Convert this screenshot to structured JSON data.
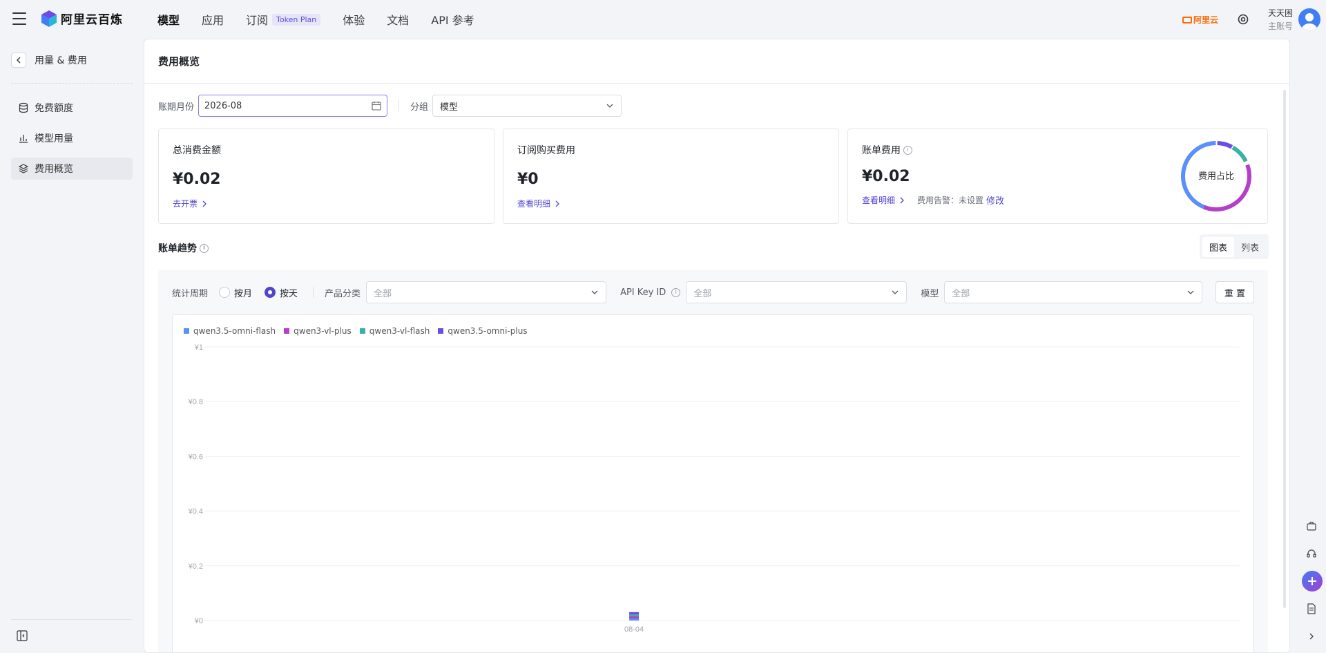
{
  "app": {
    "brand": "阿里云百炼",
    "aliyun_label": "阿里云"
  },
  "nav": {
    "items": [
      {
        "label": "模型",
        "active": true
      },
      {
        "label": "应用"
      },
      {
        "label": "订阅",
        "badge": "Token Plan"
      },
      {
        "label": "体验"
      },
      {
        "label": "文档"
      },
      {
        "label": "API 参考"
      }
    ]
  },
  "user": {
    "name": "天天困",
    "role": "主账号"
  },
  "sidebar": {
    "back_title": "用量 & 费用",
    "items": [
      {
        "label": "免费额度",
        "icon": "database-icon"
      },
      {
        "label": "模型用量",
        "icon": "bar-chart-icon"
      },
      {
        "label": "费用概览",
        "icon": "layers-icon",
        "active": true
      }
    ]
  },
  "page": {
    "title": "费用概览",
    "filters": {
      "month_label": "账期月份",
      "month_value": "2026-08",
      "group_label": "分组",
      "group_value": "模型"
    }
  },
  "cards": {
    "total": {
      "title": "总消费金额",
      "value": "¥0.02",
      "link": "去开票"
    },
    "subscription": {
      "title": "订阅购买费用",
      "value": "¥0",
      "link": "查看明细"
    },
    "bill": {
      "title": "账单费用",
      "value": "¥0.02",
      "link": "查看明细",
      "alert_text": "费用告警：未设置",
      "edit": "修改",
      "donut_label": "费用占比"
    }
  },
  "trend": {
    "title": "账单趋势",
    "view_toggle": [
      "图表",
      "列表"
    ],
    "active_view": "图表",
    "period_label": "统计周期",
    "period_options": [
      "按月",
      "按天"
    ],
    "period_selected": "按天",
    "product_label": "产品分类",
    "product_value": "全部",
    "apikey_label": "API Key ID",
    "apikey_value": "全部",
    "model_label": "模型",
    "model_value": "全部",
    "reset": "重 置"
  },
  "colors": {
    "accent": "#5145cd",
    "series": [
      "#5b8ff9",
      "#b53fc8",
      "#3bb0a6",
      "#6b4de6"
    ]
  },
  "chart_data": {
    "type": "bar",
    "stacked": true,
    "categories": [
      "08-04"
    ],
    "series": [
      {
        "name": "qwen3.5-omni-flash",
        "values": [
          0.004
        ]
      },
      {
        "name": "qwen3-vl-plus",
        "values": [
          0.006
        ]
      },
      {
        "name": "qwen3-vl-flash",
        "values": [
          0.002
        ]
      },
      {
        "name": "qwen3.5-omni-plus",
        "values": [
          0.008
        ]
      }
    ],
    "ylim": [
      0,
      1
    ],
    "yticks": [
      "¥0",
      "¥0.2",
      "¥0.4",
      "¥0.6",
      "¥0.8",
      "¥1"
    ],
    "legend": "top-left",
    "grid": true
  }
}
